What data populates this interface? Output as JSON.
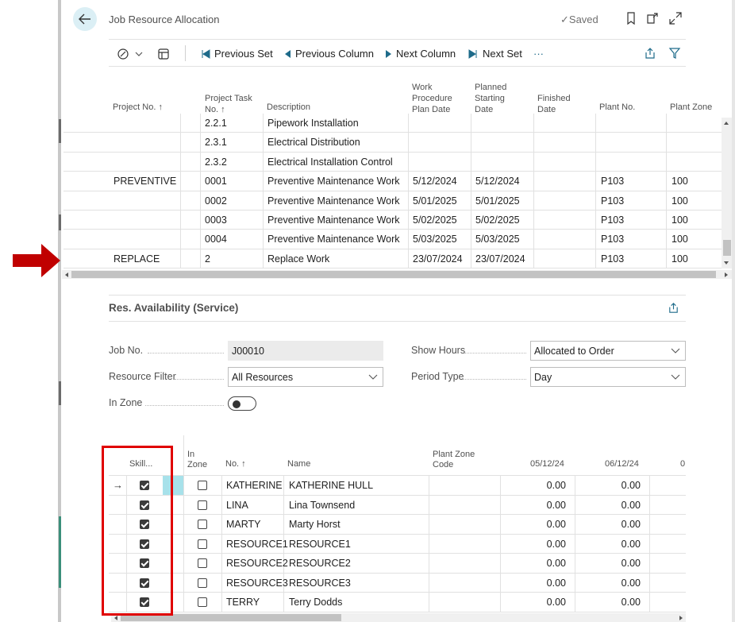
{
  "header": {
    "title": "Job Resource Allocation",
    "saved": "✓Saved"
  },
  "toolbar": {
    "previous_set": "Previous Set",
    "previous_column": "Previous Column",
    "next_column": "Next Column",
    "next_set": "Next Set",
    "more": "···"
  },
  "upper_grid": {
    "headers": {
      "project_no": "Project No. ↑",
      "task_no_1": "Project Task",
      "task_no_2": "No. ↑",
      "description": "Description",
      "work_1": "Work",
      "work_2": "Procedure",
      "work_3": "Plan Date",
      "planned_1": "Planned",
      "planned_2": "Starting",
      "planned_3": "Date",
      "finished_1": "Finished",
      "finished_2": "Date",
      "plant_no": "Plant No.",
      "plant_zone": "Plant Zone"
    },
    "rows": [
      {
        "project": "",
        "task": "2.2.1",
        "desc": "Pipework Installation",
        "work": "",
        "planned": "",
        "finished": "",
        "plant": "",
        "zone": ""
      },
      {
        "project": "",
        "task": "2.3.1",
        "desc": "Electrical Distribution",
        "work": "",
        "planned": "",
        "finished": "",
        "plant": "",
        "zone": ""
      },
      {
        "project": "",
        "task": "2.3.2",
        "desc": "Electrical Installation Control",
        "work": "",
        "planned": "",
        "finished": "",
        "plant": "",
        "zone": ""
      },
      {
        "project": "PREVENTIVE",
        "task": "0001",
        "desc": "Preventive Maintenance Work",
        "work": "5/12/2024",
        "planned": "5/12/2024",
        "finished": "",
        "plant": "P103",
        "zone": "100"
      },
      {
        "project": "",
        "task": "0002",
        "desc": "Preventive Maintenance Work",
        "work": "5/01/2025",
        "planned": "5/01/2025",
        "finished": "",
        "plant": "P103",
        "zone": "100"
      },
      {
        "project": "",
        "task": "0003",
        "desc": "Preventive Maintenance Work",
        "work": "5/02/2025",
        "planned": "5/02/2025",
        "finished": "",
        "plant": "P103",
        "zone": "100"
      },
      {
        "project": "",
        "task": "0004",
        "desc": "Preventive Maintenance Work",
        "work": "5/03/2025",
        "planned": "5/03/2025",
        "finished": "",
        "plant": "P103",
        "zone": "100"
      },
      {
        "project": "REPLACE",
        "task": "2",
        "desc": "Replace Work",
        "work": "23/07/2024",
        "planned": "23/07/2024",
        "finished": "",
        "plant": "P103",
        "zone": "100"
      }
    ]
  },
  "availability": {
    "title": "Res. Availability (Service)",
    "job_no_label": "Job No.",
    "job_no_value": "J00010",
    "resource_filter_label": "Resource Filter",
    "resource_filter_value": "All Resources",
    "in_zone_label": "In Zone",
    "show_hours_label": "Show Hours",
    "show_hours_value": "Allocated to Order",
    "period_type_label": "Period Type",
    "period_type_value": "Day",
    "in_zone_toggle": false
  },
  "lower_grid": {
    "headers": {
      "skill": "Skill...",
      "in_zone_1": "In",
      "in_zone_2": "Zone",
      "no": "No. ↑",
      "name": "Name",
      "pz_1": "Plant Zone",
      "pz_2": "Code",
      "d1": "05/12/24",
      "d2": "06/12/24",
      "d3": "0"
    },
    "rows": [
      {
        "skill": true,
        "in_zone": false,
        "no": "KATHERINE",
        "name": "KATHERINE HULL",
        "pz": "",
        "d1": "0.00",
        "d2": "0.00"
      },
      {
        "skill": true,
        "in_zone": false,
        "no": "LINA",
        "name": "Lina Townsend",
        "pz": "",
        "d1": "0.00",
        "d2": "0.00"
      },
      {
        "skill": true,
        "in_zone": false,
        "no": "MARTY",
        "name": "Marty Horst",
        "pz": "",
        "d1": "0.00",
        "d2": "0.00"
      },
      {
        "skill": true,
        "in_zone": false,
        "no": "RESOURCE1",
        "name": "RESOURCE1",
        "pz": "",
        "d1": "0.00",
        "d2": "0.00"
      },
      {
        "skill": true,
        "in_zone": false,
        "no": "RESOURCE2",
        "name": "RESOURCE2",
        "pz": "",
        "d1": "0.00",
        "d2": "0.00"
      },
      {
        "skill": true,
        "in_zone": false,
        "no": "RESOURCE3",
        "name": "RESOURCE3",
        "pz": "",
        "d1": "0.00",
        "d2": "0.00"
      },
      {
        "skill": true,
        "in_zone": false,
        "no": "TERRY",
        "name": "Terry Dodds",
        "pz": "",
        "d1": "0.00",
        "d2": "0.00"
      }
    ],
    "current_row_marker": "→"
  },
  "colors": {
    "annotation_red": "#c00000",
    "highlight_box": "#e00000",
    "selected_cell": "#a7e1ea",
    "back_button_bg": "#dbeff5"
  }
}
